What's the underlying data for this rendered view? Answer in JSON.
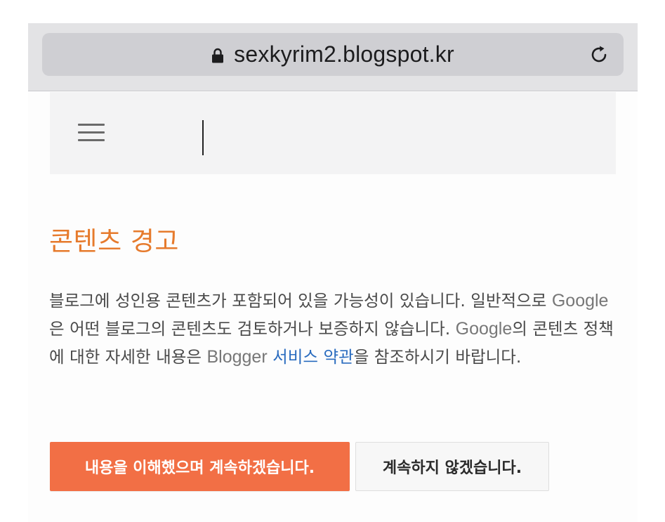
{
  "browser": {
    "url": "sexkyrim2.blogspot.kr",
    "lock_icon": "lock-icon",
    "reload_icon": "reload-icon"
  },
  "header": {
    "menu_icon": "hamburger-menu-icon"
  },
  "warning": {
    "title": "콘텐츠 경고",
    "body_p1": "블로그에 성인용 콘텐츠가 포함되어 있을 가능성이 있습니다. 일반적으로 ",
    "brand_google_1": "Google",
    "body_p2": "은 어떤 블로그의 콘텐츠도 검토하거나 보증하지 않습니다. ",
    "brand_google_2": "Google",
    "body_p3": "의 콘텐츠 정책에 대한 자세한 내용은 ",
    "brand_blogger": "Blogger",
    "terms_link": "서비스 약관",
    "body_p4": "을 참조하시기 바랍니다."
  },
  "actions": {
    "continue_label": "내용을 이해했으며 계속하겠습니다.",
    "decline_label": "계속하지 않겠습니다."
  },
  "colors": {
    "title_orange": "#e67a2c",
    "button_orange": "#f26f45",
    "link_blue": "#2a6cbf"
  }
}
